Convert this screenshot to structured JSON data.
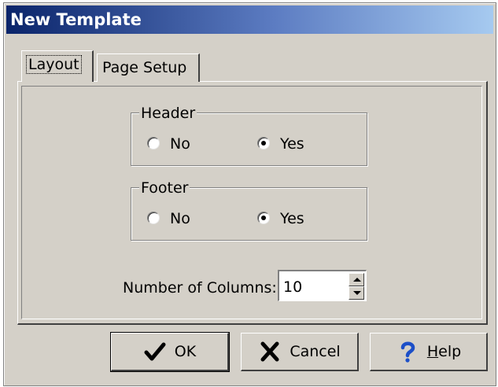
{
  "window": {
    "title": "New Template"
  },
  "tabs": [
    {
      "label": "Layout",
      "active": true
    },
    {
      "label": "Page Setup",
      "active": false
    }
  ],
  "header_group": {
    "legend": "Header",
    "options": [
      {
        "label": "No",
        "selected": false
      },
      {
        "label": "Yes",
        "selected": true
      }
    ]
  },
  "footer_group": {
    "legend": "Footer",
    "options": [
      {
        "label": "No",
        "selected": false
      },
      {
        "label": "Yes",
        "selected": true
      }
    ]
  },
  "columns": {
    "label": "Number of Columns:",
    "value": "10"
  },
  "buttons": {
    "ok": {
      "label": "OK",
      "icon": "checkmark-icon"
    },
    "cancel": {
      "label": "Cancel",
      "icon": "x-mark-icon"
    },
    "help": {
      "label_mnemonic": "H",
      "label_rest": "elp",
      "icon": "question-mark-icon"
    }
  },
  "colors": {
    "title_gradient_start": "#0a246a",
    "title_gradient_end": "#a6caf0",
    "dialog_face": "#d4d0c8",
    "help_icon": "#1c4fc8"
  }
}
